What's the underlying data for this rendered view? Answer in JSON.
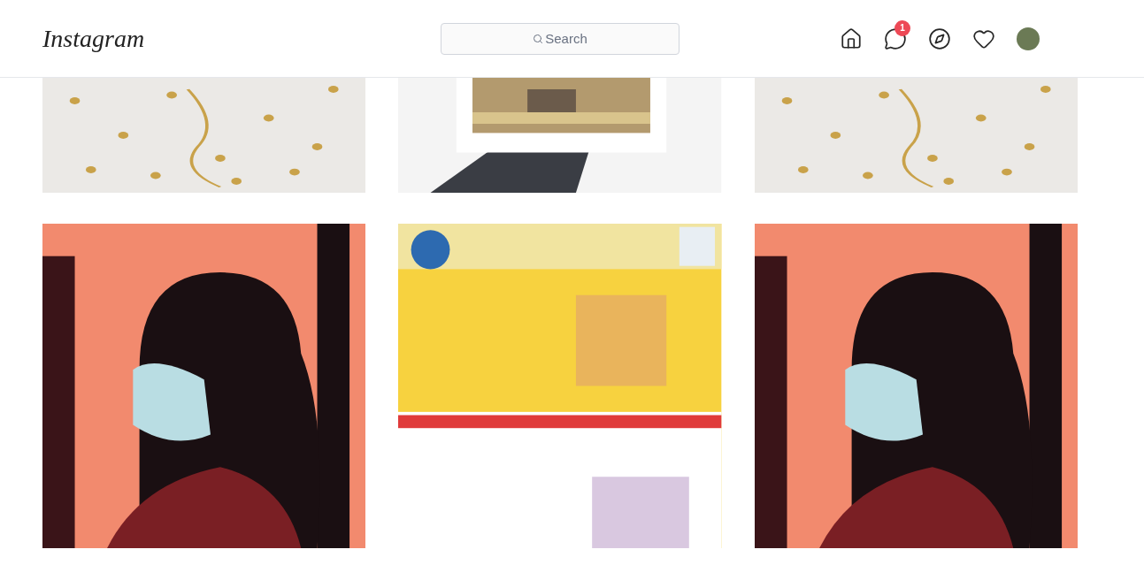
{
  "header": {
    "logo": "Instagram",
    "search": {
      "placeholder": "Search"
    },
    "messages_badge": "1"
  }
}
